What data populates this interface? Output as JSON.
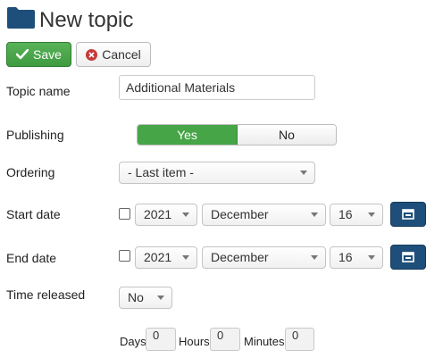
{
  "header": {
    "title": "New topic",
    "icon": "folder-icon"
  },
  "toolbar": {
    "save_label": "Save",
    "cancel_label": "Cancel"
  },
  "form": {
    "topic_name": {
      "label": "Topic name",
      "value": "Additional Materials"
    },
    "publishing": {
      "label": "Publishing",
      "yes_label": "Yes",
      "no_label": "No",
      "selected": "Yes"
    },
    "ordering": {
      "label": "Ordering",
      "value": "- Last item -"
    },
    "start_date": {
      "label": "Start date",
      "checked": false,
      "year": "2021",
      "month": "December",
      "day": "16"
    },
    "end_date": {
      "label": "End date",
      "checked": false,
      "year": "2021",
      "month": "December",
      "day": "16"
    },
    "time_released": {
      "label": "Time released",
      "value": "No",
      "days_label": "Days",
      "days_value": "0",
      "hours_label": "Hours",
      "hours_value": "0",
      "minutes_label": "Minutes",
      "minutes_value": "0"
    }
  },
  "colors": {
    "save": "#46a546",
    "cancel_icon": "#c63b3b",
    "calendar_button": "#1e4f7a",
    "folder": "#1e4f7a"
  }
}
